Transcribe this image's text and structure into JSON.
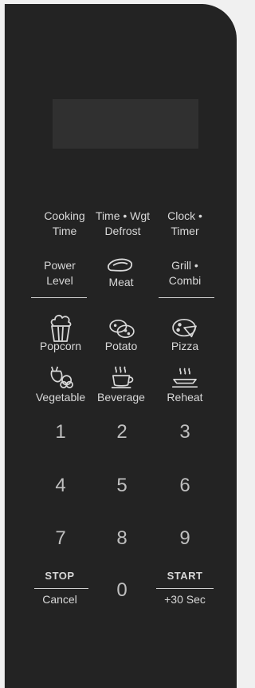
{
  "func_keys": {
    "cooking_time": {
      "line1": "Cooking",
      "line2": "Time"
    },
    "time_wgt_defrost": {
      "line1": "Time • Wgt",
      "line2": "Defrost"
    },
    "clock_timer": {
      "line1": "Clock •",
      "line2": "Timer"
    },
    "power_level": {
      "line1": "Power",
      "line2": "Level"
    },
    "meat": {
      "label": "Meat",
      "icon": "meat-icon"
    },
    "grill_combi": {
      "line1": "Grill •",
      "line2": "Combi"
    }
  },
  "food_keys": [
    {
      "label": "Popcorn",
      "icon": "popcorn-icon"
    },
    {
      "label": "Potato",
      "icon": "potato-icon"
    },
    {
      "label": "Pizza",
      "icon": "pizza-icon"
    },
    {
      "label": "Vegetable",
      "icon": "vegetable-icon"
    },
    {
      "label": "Beverage",
      "icon": "beverage-icon"
    },
    {
      "label": "Reheat",
      "icon": "reheat-icon"
    }
  ],
  "numpad": [
    "1",
    "2",
    "3",
    "4",
    "5",
    "6",
    "7",
    "8",
    "9",
    "0"
  ],
  "stop": {
    "top": "STOP",
    "bottom": "Cancel"
  },
  "start": {
    "top": "START",
    "bottom": "+30 Sec"
  },
  "colors": {
    "panel": "#232323",
    "display": "#303030",
    "text": "#d8d8d8"
  }
}
